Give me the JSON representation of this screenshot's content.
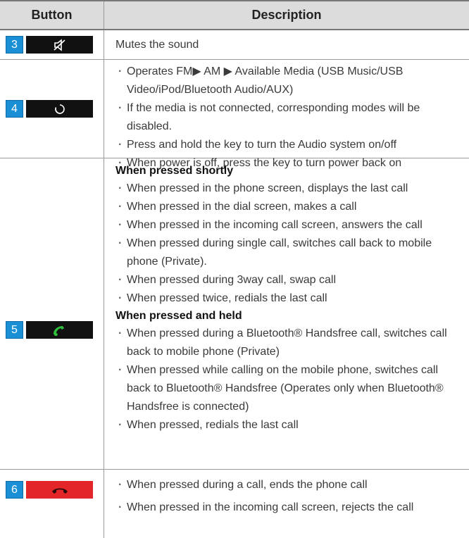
{
  "header": {
    "button": "Button",
    "description": "Description"
  },
  "rows": [
    {
      "num": "3",
      "icon": "mute-icon",
      "key_color": "#111111",
      "text": "Mutes the sound"
    },
    {
      "num": "4",
      "icon": "mode-cycle-icon",
      "key_color": "#111111",
      "bullets": [
        "Operates FM▶ AM ▶ Available Media (USB Music/USB Video/iPod/Bluetooth Audio/AUX)",
        "If the media is not connected, corresponding modes will be disabled.",
        "Press and hold the key to turn the Audio system on/off",
        "When power is off, press the key to turn power back on"
      ]
    },
    {
      "num": "5",
      "icon": "call-icon",
      "key_color": "#111111",
      "sections": [
        {
          "heading": "When pressed shortly",
          "bullets": [
            "When pressed in the phone screen, displays the last call",
            "When pressed in the dial screen, makes a call",
            "When pressed in the incoming call screen, answers the call",
            "When pressed during single call, switches call back to mobile phone (Private).",
            "When pressed during 3way call, swap call",
            "When pressed twice, redials the last call"
          ]
        },
        {
          "heading": "When pressed and held",
          "bullets": [
            "When pressed during a Bluetooth® Handsfree call, switches call back to mobile phone (Private)",
            "When pressed while calling on the mobile phone, switches call back to Bluetooth® Handsfree (Operates only when Bluetooth® Handsfree is connected)",
            "When pressed, redials the last call"
          ]
        }
      ]
    },
    {
      "num": "6",
      "icon": "end-call-icon",
      "key_color": "#e2262a",
      "bullets": [
        "When pressed during a call, ends the phone call",
        "When pressed in the incoming call screen, rejects the call"
      ]
    }
  ]
}
